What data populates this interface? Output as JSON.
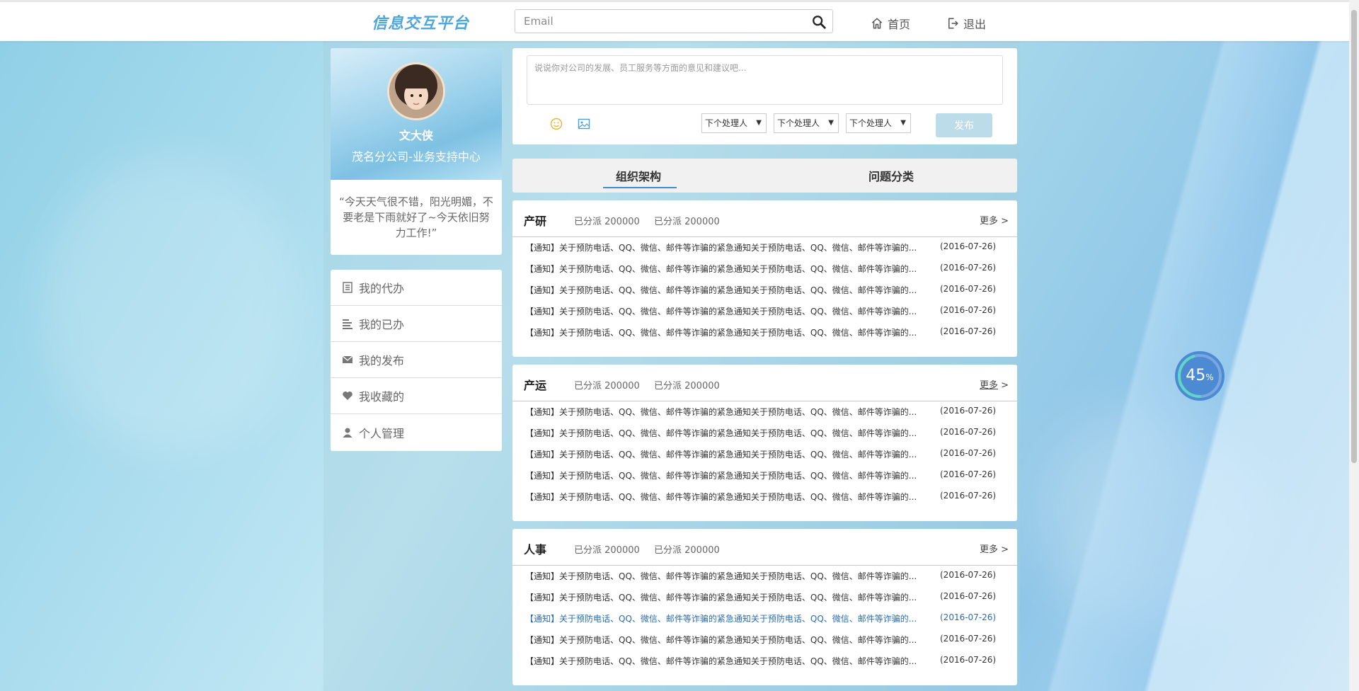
{
  "header": {
    "logo": "信息交互平台",
    "search_placeholder": "Email",
    "nav_home": "首页",
    "nav_logout": "退出"
  },
  "profile": {
    "name": "文大侠",
    "department": "茂名分公司-业务支持中心",
    "motto": "“今天天气很不错，阳光明媚，不要老是下雨就好了~今天依旧努力工作!”"
  },
  "menu": [
    {
      "label": "我的代办",
      "icon": "todo-list-icon"
    },
    {
      "label": "我的已办",
      "icon": "done-list-icon"
    },
    {
      "label": "我的发布",
      "icon": "mail-icon"
    },
    {
      "label": "我收藏的",
      "icon": "heart-icon"
    },
    {
      "label": "个人管理",
      "icon": "user-icon"
    }
  ],
  "post": {
    "placeholder": "说说你对公司的发展、员工服务等方面的意见和建议吧...",
    "selects": [
      "下个处理人",
      "下个处理人",
      "下个处理人"
    ],
    "publish_label": "发布"
  },
  "tabs": [
    {
      "label": "组织架构",
      "active": true
    },
    {
      "label": "问题分类",
      "active": false
    }
  ],
  "sections": [
    {
      "title": "产研",
      "stat1": "已分派 200000",
      "stat2": "已分派 200000",
      "more": "更多",
      "items": [
        {
          "text": "【通知】关于预防电话、QQ、微信、邮件等诈骗的紧急通知关于预防电话、QQ、微信、邮件等诈骗的...",
          "date": "(2016-07-26)"
        },
        {
          "text": "【通知】关于预防电话、QQ、微信、邮件等诈骗的紧急通知关于预防电话、QQ、微信、邮件等诈骗的...",
          "date": "(2016-07-26)"
        },
        {
          "text": "【通知】关于预防电话、QQ、微信、邮件等诈骗的紧急通知关于预防电话、QQ、微信、邮件等诈骗的...",
          "date": "(2016-07-26)"
        },
        {
          "text": "【通知】关于预防电话、QQ、微信、邮件等诈骗的紧急通知关于预防电话、QQ、微信、邮件等诈骗的...",
          "date": "(2016-07-26)"
        },
        {
          "text": "【通知】关于预防电话、QQ、微信、邮件等诈骗的紧急通知关于预防电话、QQ、微信、邮件等诈骗的...",
          "date": "(2016-07-26)"
        }
      ]
    },
    {
      "title": "产运",
      "stat1": "已分派 200000",
      "stat2": "已分派 200000",
      "more": "更多",
      "items": [
        {
          "text": "【通知】关于预防电话、QQ、微信、邮件等诈骗的紧急通知关于预防电话、QQ、微信、邮件等诈骗的...",
          "date": "(2016-07-26)"
        },
        {
          "text": "【通知】关于预防电话、QQ、微信、邮件等诈骗的紧急通知关于预防电话、QQ、微信、邮件等诈骗的...",
          "date": "(2016-07-26)"
        },
        {
          "text": "【通知】关于预防电话、QQ、微信、邮件等诈骗的紧急通知关于预防电话、QQ、微信、邮件等诈骗的...",
          "date": "(2016-07-26)"
        },
        {
          "text": "【通知】关于预防电话、QQ、微信、邮件等诈骗的紧急通知关于预防电话、QQ、微信、邮件等诈骗的...",
          "date": "(2016-07-26)"
        },
        {
          "text": "【通知】关于预防电话、QQ、微信、邮件等诈骗的紧急通知关于预防电话、QQ、微信、邮件等诈骗的...",
          "date": "(2016-07-26)"
        }
      ]
    },
    {
      "title": "人事",
      "stat1": "已分派 200000",
      "stat2": "已分派 200000",
      "more": "更多",
      "items": [
        {
          "text": "【通知】关于预防电话、QQ、微信、邮件等诈骗的紧急通知关于预防电话、QQ、微信、邮件等诈骗的...",
          "date": "(2016-07-26)"
        },
        {
          "text": "【通知】关于预防电话、QQ、微信、邮件等诈骗的紧急通知关于预防电话、QQ、微信、邮件等诈骗的...",
          "date": "(2016-07-26)"
        },
        {
          "text": "【通知】关于预防电话、QQ、微信、邮件等诈骗的紧急通知关于预防电话、QQ、微信、邮件等诈骗的...",
          "date": "(2016-07-26)"
        },
        {
          "text": "【通知】关于预防电话、QQ、微信、邮件等诈骗的紧急通知关于预防电话、QQ、微信、邮件等诈骗的...",
          "date": "(2016-07-26)"
        },
        {
          "text": "【通知】关于预防电话、QQ、微信、邮件等诈骗的紧急通知关于预防电话、QQ、微信、邮件等诈骗的...",
          "date": "(2016-07-26)"
        }
      ]
    }
  ],
  "progress": {
    "value": "45",
    "unit": "%",
    "fraction": 0.45
  },
  "colors": {
    "accent": "#3a8fd0",
    "logo": "#4fa6d8",
    "publish_disabled": "#bcdcea",
    "link_active": "#2b6cb0",
    "progress": "#4c8ad3"
  }
}
